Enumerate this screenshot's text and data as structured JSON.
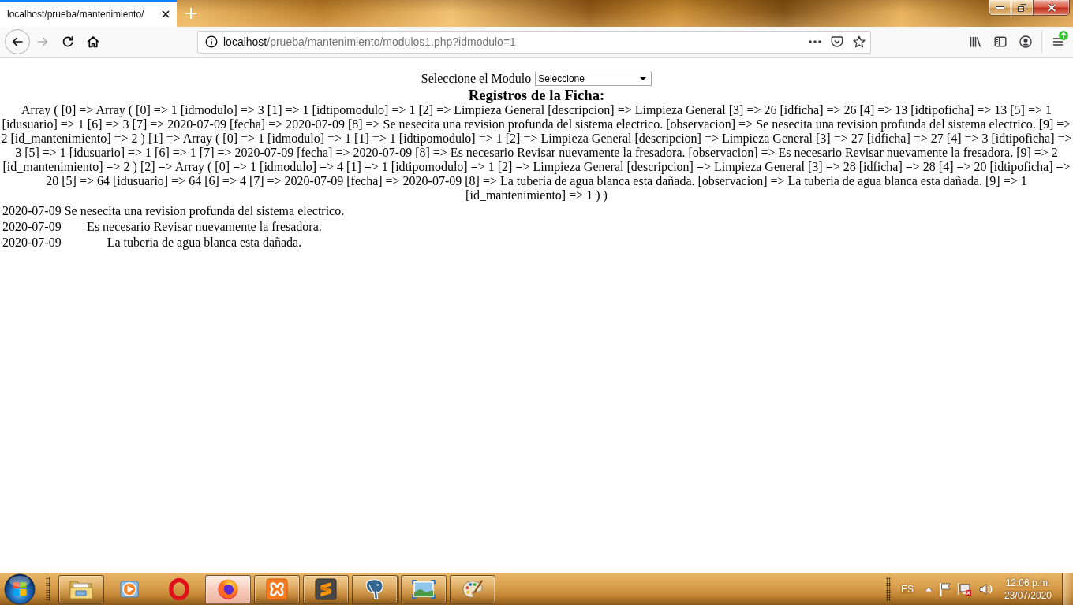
{
  "window": {
    "tabs": [
      {
        "title": "localhost/prueba/mantenimiento/",
        "selected": true
      }
    ]
  },
  "toolbar": {
    "nav_buttons": [
      {
        "kind": "back",
        "disabled": false
      },
      {
        "kind": "forward",
        "disabled": true
      },
      {
        "kind": "reload",
        "disabled": false
      },
      {
        "kind": "home",
        "disabled": false
      }
    ],
    "address": {
      "host": "localhost",
      "path": "/prueba/mantenimiento/modulos1.php?idmodulo=1"
    },
    "update_badge": true
  },
  "page": {
    "module_label": "Seleccione el Modulo",
    "module_select": "Seleccione",
    "heading": "Registros de la Ficha:",
    "debug_output": "Array ( [0] => Array ( [0] => 1 [idmodulo] => 3 [1] => 1 [idtipomodulo] => 1 [2] => Limpieza General [descripcion] => Limpieza General [3] => 26 [idficha] => 26 [4] => 13 [idtipoficha] => 13 [5] => 1 [idusuario] => 1 [6] => 3 [7] => 2020-07-09 [fecha] => 2020-07-09 [8] => Se nesecita una revision profunda del sistema electrico. [observacion] => Se nesecita una revision profunda del sistema electrico. [9] => 2 [id_mantenimiento] => 2 ) [1] => Array ( [0] => 1 [idmodulo] => 1 [1] => 1 [idtipomodulo] => 1 [2] => Limpieza General [descripcion] => Limpieza General [3] => 27 [idficha] => 27 [4] => 3 [idtipoficha] => 3 [5] => 1 [idusuario] => 1 [6] => 1 [7] => 2020-07-09 [fecha] => 2020-07-09 [8] => Es necesario Revisar nuevamente la fresadora. [observacion] => Es necesario Revisar nuevamente la fresadora. [9] => 2 [id_mantenimiento] => 2 ) [2] => Array ( [0] => 1 [idmodulo] => 4 [1] => 1 [idtipomodulo] => 1 [2] => Limpieza General [descripcion] => Limpieza General [3] => 28 [idficha] => 28 [4] => 20 [idtipoficha] => 20 [5] => 64 [idusuario] => 64 [6] => 4 [7] => 2020-07-09 [fecha] => 2020-07-09 [8] => La tuberia de agua blanca esta dañada. [observacion] => La tuberia de agua blanca esta dañada. [9] => 1 [id_mantenimiento] => 1 ) )",
    "records": [
      {
        "date": "2020-07-09",
        "observation": "Se nesecita una revision profunda del sistema electrico."
      },
      {
        "date": "2020-07-09",
        "observation": "Es necesario Revisar nuevamente la fresadora."
      },
      {
        "date": "2020-07-09",
        "observation": "La tuberia de agua blanca esta dañada."
      }
    ]
  },
  "taskbar": {
    "apps": [
      {
        "kind": "folder",
        "running": true,
        "selected": false,
        "stacked": false
      },
      {
        "kind": "play",
        "running": false,
        "selected": false,
        "stacked": false
      },
      {
        "kind": "ring",
        "running": false,
        "selected": false,
        "stacked": false
      },
      {
        "kind": "globe",
        "running": true,
        "selected": true,
        "stacked": false
      },
      {
        "kind": "knot",
        "running": true,
        "selected": false,
        "stacked": false
      },
      {
        "kind": "stripes",
        "running": true,
        "selected": false,
        "stacked": false
      },
      {
        "kind": "elephant",
        "running": true,
        "selected": false,
        "stacked": true
      },
      {
        "kind": "picture",
        "running": true,
        "selected": false,
        "stacked": false
      },
      {
        "kind": "palette",
        "running": true,
        "selected": false,
        "stacked": false
      }
    ],
    "tray": {
      "language": "ES",
      "time": "12:06 p.m.",
      "date": "23/07/2020"
    }
  }
}
